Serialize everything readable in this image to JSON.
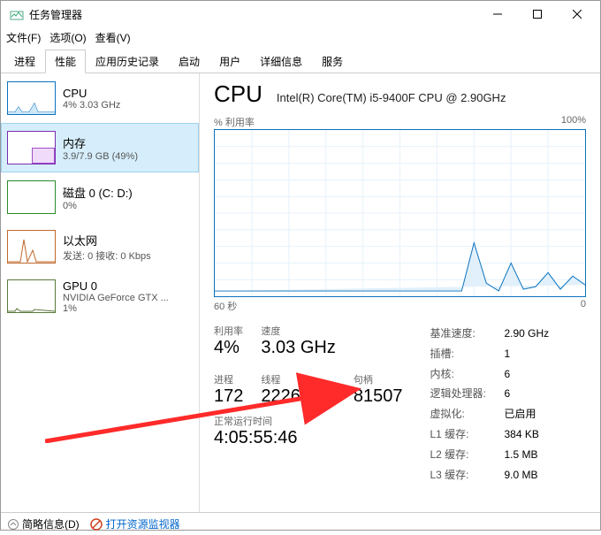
{
  "window": {
    "title": "任务管理器"
  },
  "menu": {
    "file": "文件(F)",
    "options": "选项(O)",
    "view": "查看(V)"
  },
  "tabs": {
    "processes": "进程",
    "performance": "性能",
    "apphistory": "应用历史记录",
    "startup": "启动",
    "users": "用户",
    "details": "详细信息",
    "services": "服务"
  },
  "sidebar": {
    "cpu": {
      "name": "CPU",
      "val": "4% 3.03 GHz"
    },
    "mem": {
      "name": "内存",
      "val": "3.9/7.9 GB (49%)"
    },
    "disk": {
      "name": "磁盘 0 (C: D:)",
      "val": "0%"
    },
    "eth": {
      "name": "以太网",
      "val": "发送: 0 接收: 0 Kbps"
    },
    "gpu": {
      "name": "GPU 0",
      "val1": "NVIDIA GeForce GTX ...",
      "val2": "1%"
    }
  },
  "main": {
    "title": "CPU",
    "model": "Intel(R) Core(TM) i5-9400F CPU @ 2.90GHz",
    "chart_top_left": "% 利用率",
    "chart_top_right": "100%",
    "chart_bot_left": "60 秒",
    "chart_bot_right": "0",
    "stats": {
      "util_l": "利用率",
      "util_v": "4%",
      "speed_l": "速度",
      "speed_v": "3.03 GHz",
      "proc_l": "进程",
      "proc_v": "172",
      "thread_l": "线程",
      "thread_v": "2226",
      "handle_l": "句柄",
      "handle_v": "81507",
      "uptime_l": "正常运行时间",
      "uptime_v": "4:05:55:46"
    },
    "right": {
      "base_l": "基准速度:",
      "base_v": "2.90 GHz",
      "sock_l": "插槽:",
      "sock_v": "1",
      "core_l": "内核:",
      "core_v": "6",
      "lp_l": "逻辑处理器:",
      "lp_v": "6",
      "virt_l": "虚拟化:",
      "virt_v": "已启用",
      "l1_l": "L1 缓存:",
      "l1_v": "384 KB",
      "l2_l": "L2 缓存:",
      "l2_v": "1.5 MB",
      "l3_l": "L3 缓存:",
      "l3_v": "9.0 MB"
    }
  },
  "footer": {
    "fewer": "简略信息(D)",
    "resmon": "打开资源监视器"
  },
  "chart_data": {
    "type": "line",
    "title": "% 利用率",
    "xlabel": "60 秒",
    "ylabel": "",
    "ylim": [
      0,
      100
    ],
    "x_seconds_ago": [
      60,
      55,
      50,
      45,
      40,
      35,
      30,
      25,
      20,
      18,
      16,
      14,
      12,
      10,
      8,
      6,
      4,
      2,
      0
    ],
    "values": [
      3,
      3,
      3,
      3,
      3,
      3,
      3,
      3,
      3,
      32,
      8,
      3,
      20,
      4,
      6,
      14,
      4,
      12,
      7
    ]
  }
}
